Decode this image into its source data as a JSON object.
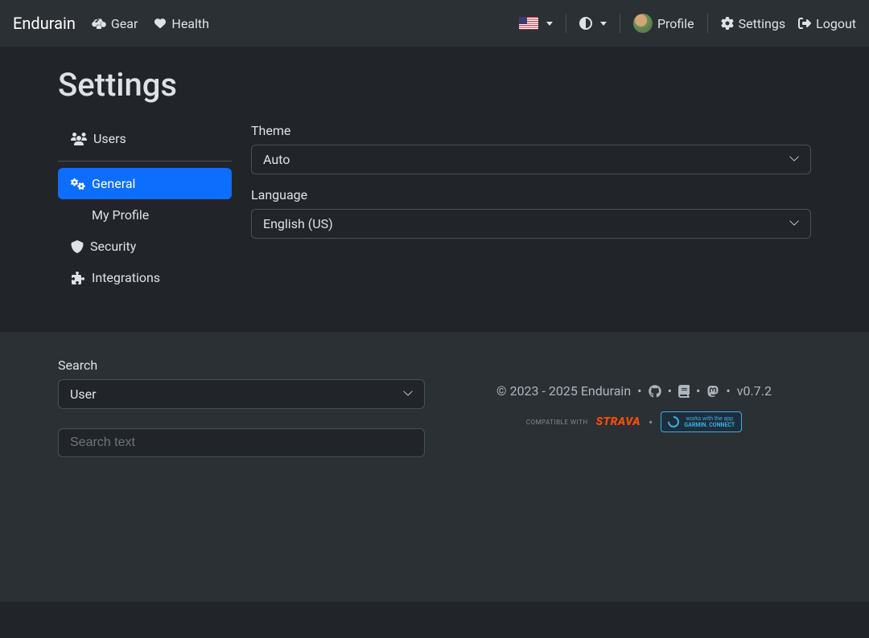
{
  "nav": {
    "brand": "Endurain",
    "gear": "Gear",
    "health": "Health",
    "profile": "Profile",
    "settings": "Settings",
    "logout": "Logout"
  },
  "page": {
    "title": "Settings"
  },
  "sidebar": {
    "users": "Users",
    "general": "General",
    "profile": "My Profile",
    "security": "Security",
    "integrations": "Integrations"
  },
  "content": {
    "theme_label": "Theme",
    "theme_value": "Auto",
    "language_label": "Language",
    "language_value": "English (US)"
  },
  "footer": {
    "search_label": "Search",
    "search_type": "User",
    "search_placeholder": "Search text",
    "copyright": "© 2023 - 2025 Endurain",
    "version": "v0.7.2",
    "compatible": "COMPATIBLE WITH",
    "strava": "STRAVA",
    "garmin_top": "works with the app",
    "garmin_bottom": "GARMIN. CONNECT"
  }
}
